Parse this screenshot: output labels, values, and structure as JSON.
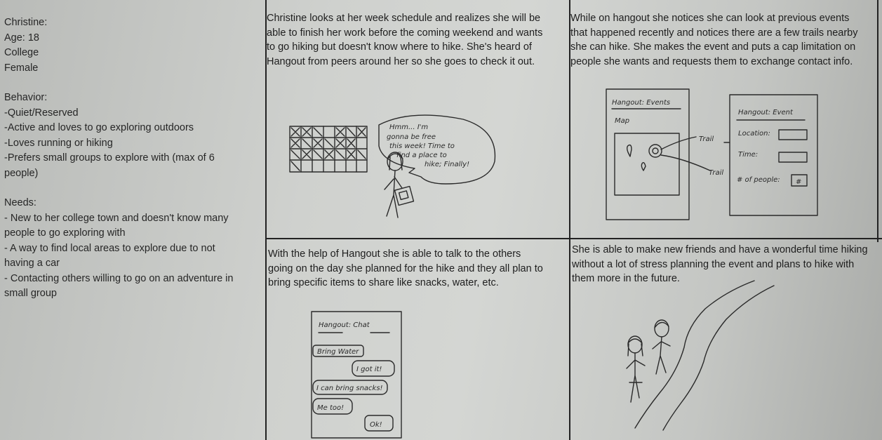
{
  "persona": {
    "name": "Christine:",
    "age": "Age: 18",
    "school": "College",
    "gender": "Female",
    "behavior_heading": "Behavior:",
    "behavior": [
      "-Quiet/Reserved",
      "-Active and loves to go exploring outdoors",
      "-Loves running or hiking",
      "-Prefers small groups to explore with (max of 6",
      "people)"
    ],
    "needs_heading": "Needs:",
    "needs": [
      "- New to her college town and doesn't know many",
      "people to go exploring with",
      "- A way to find local areas to explore due to not",
      "having a car",
      "- Contacting others willing to go on an adventure in",
      "small group"
    ]
  },
  "panels": [
    {
      "lines": [
        "Christine looks at her week schedule and realizes she will be",
        "able to finish her work before the coming weekend and wants",
        "to go hiking but doesn't know where to hike. She's heard of",
        "Hangout from peers around her so she goes to check it out."
      ],
      "sketch": {
        "speech": [
          "Hmm... I'm",
          "gonna be free",
          "this week! Time to",
          "find a place to",
          "hike; Finally!"
        ]
      }
    },
    {
      "lines": [
        "While on hangout she notices she can look at previous events",
        "that happened recently and notices there are a few trails nearby",
        "she can hike. She makes the event and puts a cap limitation on",
        "people she wants and requests them to exchange contact info."
      ],
      "sketch": {
        "left_screen_title": "Hangout: Events",
        "map_label": "Map",
        "trail_label_1": "Trail",
        "trail_label_2": "Trail",
        "right_screen_title": "Hangout: Event",
        "location_label": "Location:",
        "time_label": "Time:",
        "people_label": "# of people:",
        "people_value": "#"
      }
    },
    {
      "lines": [
        "With the help of Hangout she is able to talk to the others",
        "going on the day she planned for the hike and they all plan to",
        "bring specific items to share like snacks, water, etc."
      ],
      "sketch": {
        "chat_title": "Hangout: Chat",
        "messages": [
          "Bring Water",
          "I got it!",
          "I can bring snacks!",
          "Me too!",
          "Ok!"
        ]
      }
    },
    {
      "lines": [
        "She is able to make new friends and have a wonderful time hiking",
        "without a lot of stress planning the event and plans to hike with",
        "them more in the future."
      ]
    }
  ]
}
